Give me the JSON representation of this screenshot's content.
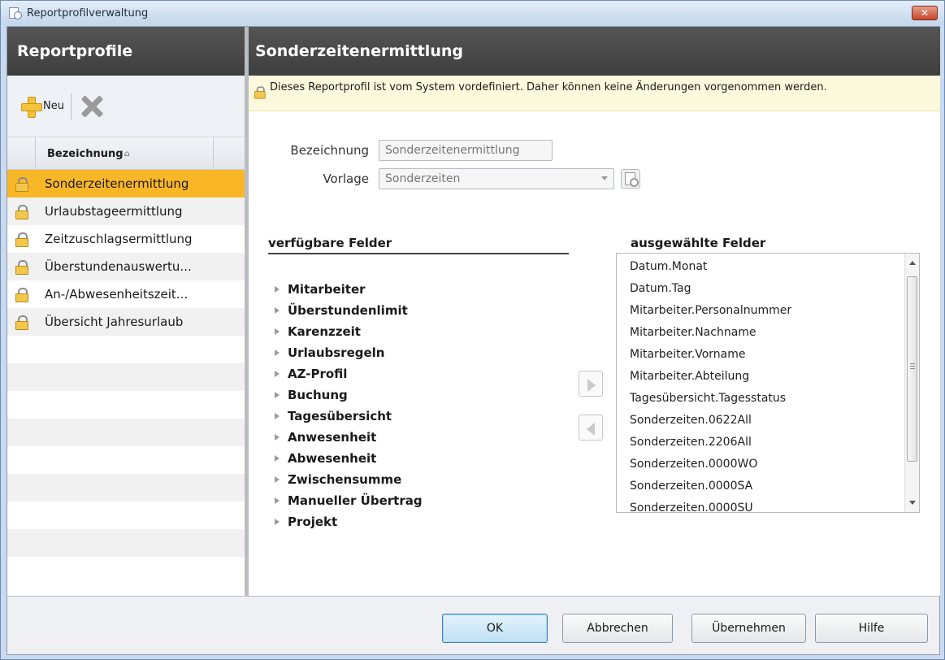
{
  "window": {
    "title": "Reportprofilverwaltung",
    "close_label": "✕"
  },
  "left": {
    "header": "Reportprofile",
    "toolbar": {
      "new_label": "Neu"
    },
    "column_header": "Bezeichnung",
    "sort_indicator": "⌂",
    "items": [
      {
        "label": "Sonderzeitenermittlung",
        "selected": true
      },
      {
        "label": "Urlaubstageermittlung"
      },
      {
        "label": "Zeitzuschlagsermittlung"
      },
      {
        "label": "Überstundenauswertu..."
      },
      {
        "label": "An-/Abwesenheitszeit..."
      },
      {
        "label": "Übersicht Jahresurlaub"
      }
    ]
  },
  "right": {
    "header": "Sonderzeitenermittlung",
    "info_text": "Dieses Reportprofil ist vom System vordefiniert. Daher können keine Änderungen vorgenommen werden.",
    "form": {
      "name_label": "Bezeichnung",
      "name_value": "Sonderzeitenermittlung",
      "template_label": "Vorlage",
      "template_value": "Sonderzeiten"
    },
    "available_title": "verfügbare Felder",
    "selected_title": "ausgewählte Felder",
    "available_fields": [
      "Mitarbeiter",
      "Überstundenlimit",
      "Karenzzeit",
      "Urlaubsregeln",
      "AZ-Profil",
      "Buchung",
      "Tagesübersicht",
      "Anwesenheit",
      "Abwesenheit",
      "Zwischensumme",
      "Manueller Übertrag",
      "Projekt"
    ],
    "selected_fields": [
      "Datum.Monat",
      "Datum.Tag",
      "Mitarbeiter.Personalnummer",
      "Mitarbeiter.Nachname",
      "Mitarbeiter.Vorname",
      "Mitarbeiter.Abteilung",
      "Tagesübersicht.Tagesstatus",
      "Sonderzeiten.0622All",
      "Sonderzeiten.2206All",
      "Sonderzeiten.0000WO",
      "Sonderzeiten.0000SA",
      "Sonderzeiten.0000SU"
    ]
  },
  "footer": {
    "ok_label": "OK",
    "cancel_label": "Abbrechen",
    "apply_label": "Übernehmen",
    "help_label": "Hilfe"
  },
  "colors": {
    "selection": "#f9b728",
    "header_bg": "#444444",
    "info_bg": "#fdf9dc"
  }
}
